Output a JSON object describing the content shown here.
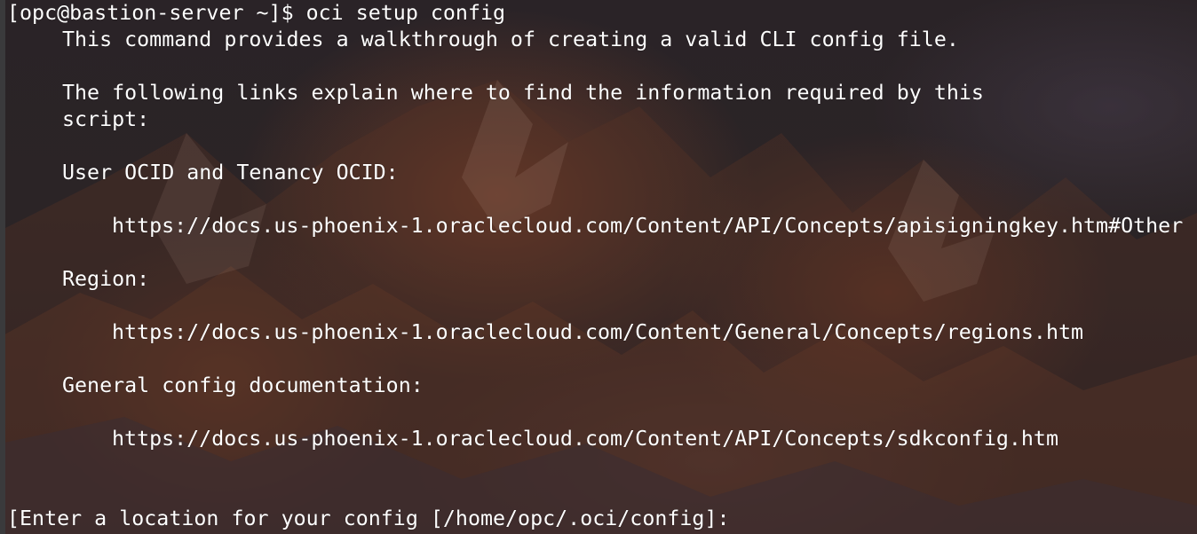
{
  "terminal": {
    "prompt_line": "[opc@bastion-server ~]$ oci setup config",
    "intro": "This command provides a walkthrough of creating a valid CLI config file.",
    "links_intro_1": "The following links explain where to find the information required by this",
    "links_intro_2": "script:",
    "user_ocid_heading": "User OCID and Tenancy OCID:",
    "user_ocid_url": "https://docs.us-phoenix-1.oraclecloud.com/Content/API/Concepts/apisigningkey.htm#Other",
    "region_heading": "Region:",
    "region_url": "https://docs.us-phoenix-1.oraclecloud.com/Content/General/Concepts/regions.htm",
    "general_heading": "General config documentation:",
    "general_url": "https://docs.us-phoenix-1.oraclecloud.com/Content/API/Concepts/sdkconfig.htm",
    "location_prompt": "[Enter a location for your config [/home/opc/.oci/config]:"
  }
}
